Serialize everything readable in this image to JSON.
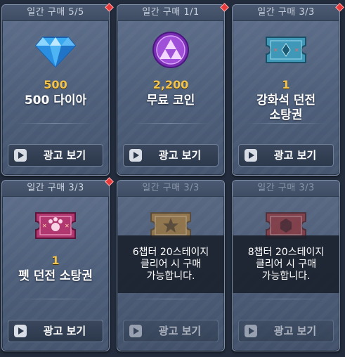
{
  "cards": [
    {
      "header": "일간 구매 5/5",
      "amount": "500",
      "name": "500 다이아",
      "button": "광고 보기",
      "icon": "diamond-icon",
      "new": true,
      "locked": false
    },
    {
      "header": "일간 구매 1/1",
      "amount": "2,200",
      "name": "무료 코인",
      "button": "광고 보기",
      "icon": "coin-icon",
      "new": true,
      "locked": false
    },
    {
      "header": "일간 구매 3/3",
      "amount": "1",
      "name": "강화석 던전\n소탕권",
      "button": "광고 보기",
      "icon": "enhance-ticket-icon",
      "new": true,
      "locked": false
    },
    {
      "header": "일간 구매 3/3",
      "amount": "1",
      "name": "펫 던전 소탕권",
      "button": "광고 보기",
      "icon": "pet-ticket-icon",
      "new": true,
      "locked": false
    },
    {
      "header": "일간 구매 3/3",
      "amount": "",
      "name": "",
      "button": "광고 보기",
      "icon": "gold-ticket-icon",
      "new": false,
      "locked": true,
      "lock_text": "6챕터 20스테이지\n클리어 시 구매\n가능합니다."
    },
    {
      "header": "일간 구매 3/3",
      "amount": "",
      "name": "",
      "button": "광고 보기",
      "icon": "red-ticket-icon",
      "new": false,
      "locked": true,
      "lock_text": "8챕터 20스테이지\n클리어 시 구매\n가능합니다."
    }
  ],
  "colors": {
    "amount": "#f4c34b",
    "new_dot": "#e83a3a",
    "card": "#55667f"
  }
}
